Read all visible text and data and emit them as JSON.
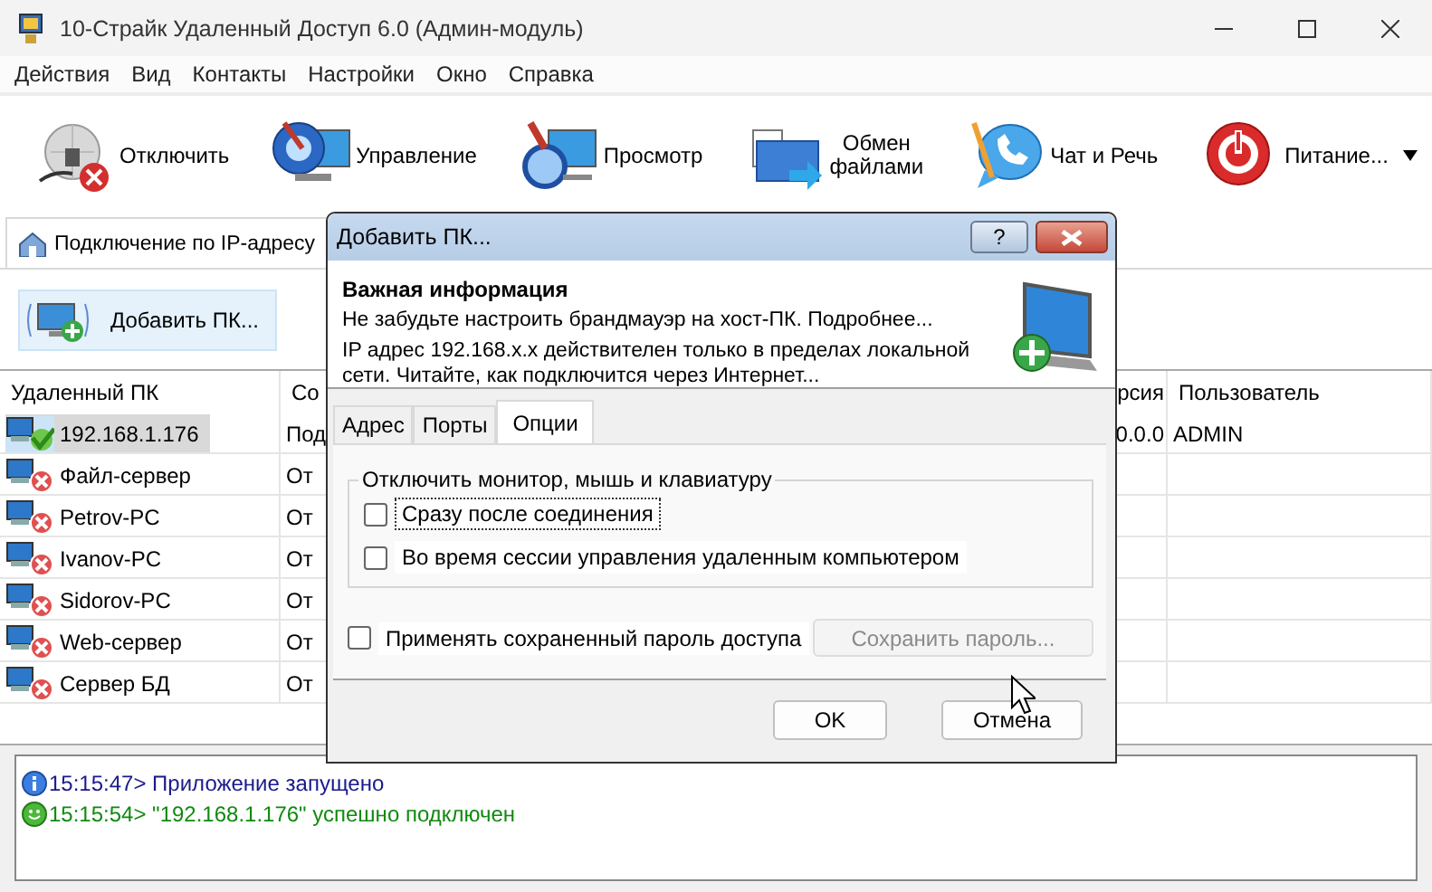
{
  "window": {
    "title": "10-Страйк Удаленный Доступ 6.0 (Админ-модуль)"
  },
  "menu": [
    "Действия",
    "Вид",
    "Контакты",
    "Настройки",
    "Окно",
    "Справка"
  ],
  "toolbar": [
    {
      "kind": "disconnect",
      "label": "Отключить"
    },
    {
      "kind": "control",
      "label": "Управление"
    },
    {
      "kind": "view",
      "label": "Просмотр"
    },
    {
      "kind": "files",
      "label": "Обмен\nфайлами"
    },
    {
      "kind": "chat",
      "label": "Чат и Речь"
    },
    {
      "kind": "power",
      "label": "Питание...",
      "dropdown": true
    }
  ],
  "tabs": [
    {
      "label": "Подключение по IP-адресу",
      "selected": true
    }
  ],
  "add_button": {
    "label": "Добавить ПК..."
  },
  "table": {
    "columns": [
      "Удаленный ПК",
      "Со",
      "рсия",
      "Пользователь"
    ],
    "rows": [
      {
        "name": "192.168.1.176",
        "column_2": "Под",
        "column_3": "0.0.0",
        "column_4": "ADMIN",
        "kind": "connected",
        "selected": true
      },
      {
        "name": "Файл-сервер",
        "column_2": "От",
        "kind": "disconnected",
        "selected": false
      },
      {
        "name": "Petrov-PC",
        "column_2": "От",
        "kind": "disconnected",
        "selected": false
      },
      {
        "name": "Ivanov-PC",
        "column_2": "От",
        "kind": "disconnected",
        "selected": false
      },
      {
        "name": "Sidorov-PC",
        "column_2": "От",
        "kind": "disconnected",
        "selected": false
      },
      {
        "name": "Web-сервер",
        "column_2": "От",
        "kind": "disconnected",
        "selected": false
      },
      {
        "name": "Сервер БД",
        "column_2": "От",
        "kind": "disconnected",
        "selected": false
      }
    ]
  },
  "log": [
    {
      "kind": "info",
      "text": "15:15:47> Приложение запущено"
    },
    {
      "kind": "success",
      "text": "15:15:54> \"192.168.1.176\" успешно подключен"
    }
  ],
  "dialog": {
    "title": "Добавить ПК...",
    "help_button": "?",
    "info": {
      "heading": "Важная информация",
      "lines": [
        "Не забудьте настроить брандмауэр на хост-ПК. Подробнее...",
        "IP адрес 192.168.x.x действителен только в пределах локальной сети. Читайте, как подключится через Интернет..."
      ]
    },
    "tabs": [
      {
        "label": "Адрес",
        "selected": false
      },
      {
        "label": "Порты",
        "selected": false
      },
      {
        "label": "Опции",
        "selected": true
      }
    ],
    "group": {
      "title": "Отключить монитор, мышь и клавиатуру",
      "checkboxes": [
        {
          "label": "Сразу после соединения",
          "checked": false,
          "focused": true
        },
        {
          "label": "Во время сессии управления удаленным компьютером",
          "checked": false,
          "focused": false
        }
      ]
    },
    "password_checkbox": {
      "label": "Применять сохраненный пароль доступа",
      "checked": false
    },
    "save_password_button": {
      "label": "Сохранить пароль...",
      "disabled": true
    },
    "buttons": [
      {
        "label": "OK"
      },
      {
        "label": "Отмена"
      }
    ]
  }
}
